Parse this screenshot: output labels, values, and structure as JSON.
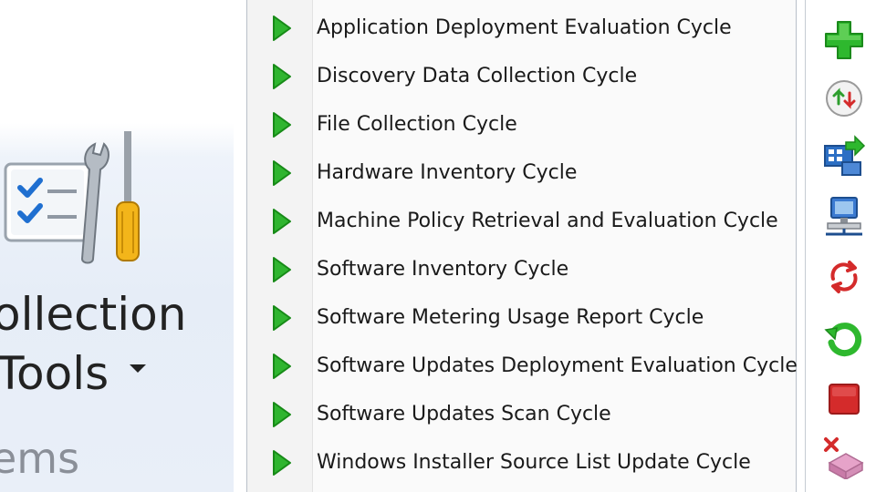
{
  "ribbon": {
    "button_line1": "ollection",
    "button_line2": "Tools",
    "group_label": "ems",
    "icon": "client-tools-icon"
  },
  "menu": {
    "items": [
      {
        "label": "Application Deployment Evaluation Cycle",
        "icon": "play-icon"
      },
      {
        "label": "Discovery Data Collection Cycle",
        "icon": "play-icon"
      },
      {
        "label": "File Collection Cycle",
        "icon": "play-icon"
      },
      {
        "label": "Hardware Inventory Cycle",
        "icon": "play-icon"
      },
      {
        "label": "Machine Policy Retrieval and Evaluation Cycle",
        "icon": "play-icon"
      },
      {
        "label": "Software Inventory Cycle",
        "icon": "play-icon"
      },
      {
        "label": "Software Metering Usage Report Cycle",
        "icon": "play-icon"
      },
      {
        "label": "Software Updates Deployment Evaluation Cycle",
        "icon": "play-icon"
      },
      {
        "label": "Software Updates Scan Cycle",
        "icon": "play-icon"
      },
      {
        "label": "Windows Installer Source List Update Cycle",
        "icon": "play-icon"
      }
    ]
  },
  "toolbar": {
    "icons": [
      "add-icon",
      "sort-order-icon",
      "deploy-to-computers-icon",
      "computer-network-icon",
      "refresh-cycle-icon",
      "restart-icon",
      "stop-icon",
      "delete-icon"
    ]
  },
  "colors": {
    "play_green": "#2fb52f",
    "stop_red": "#d42b2b",
    "add_green": "#2eb82e",
    "menu_bg": "#fafafa",
    "ribbon_bg": "#e6edf7"
  }
}
